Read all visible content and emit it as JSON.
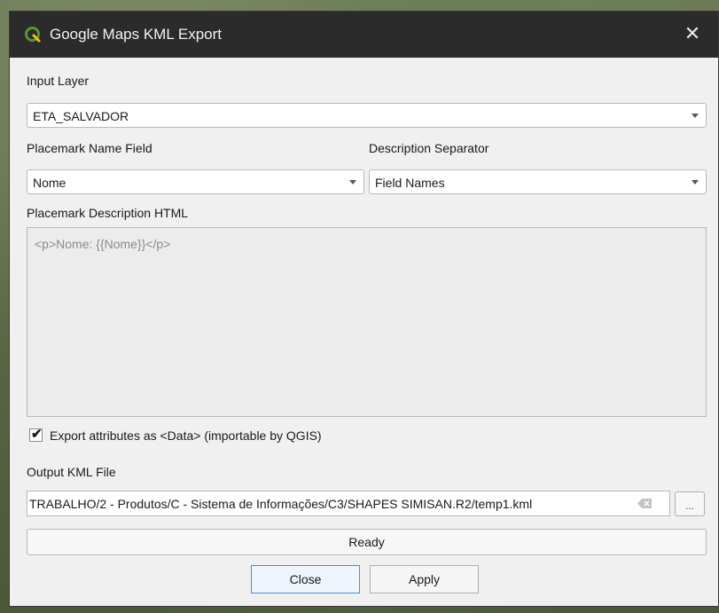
{
  "window": {
    "title": "Google Maps KML Export",
    "close_glyph": "✕",
    "icon": "qgis-icon"
  },
  "input_layer": {
    "label": "Input Layer",
    "value": "ETA_SALVADOR"
  },
  "placemark_name_field": {
    "label": "Placemark Name Field",
    "value": "Nome"
  },
  "description_separator": {
    "label": "Description Separator",
    "value": "Field Names"
  },
  "placemark_description": {
    "label": "Placemark Description HTML",
    "placeholder": "<p>Nome: {{Nome}}</p>"
  },
  "export_attributes": {
    "label": "Export attributes as <Data> (importable by QGIS)",
    "checked": true,
    "check_glyph": "✔"
  },
  "output_file": {
    "label": "Output KML File",
    "value": "TRABALHO/2 - Produtos/C - Sistema de Informações/C3/SHAPES SIMISAN.R2/temp1.kml",
    "browse_label": "..."
  },
  "status": {
    "text": "Ready"
  },
  "buttons": {
    "close": "Close",
    "apply": "Apply"
  },
  "colors": {
    "titlebar": "#2b2b2b",
    "dialog_bg": "#f0f0f0",
    "default_button_border": "#4a90d9",
    "qgis_green": "#589632",
    "qgis_yellow": "#eec90d"
  }
}
